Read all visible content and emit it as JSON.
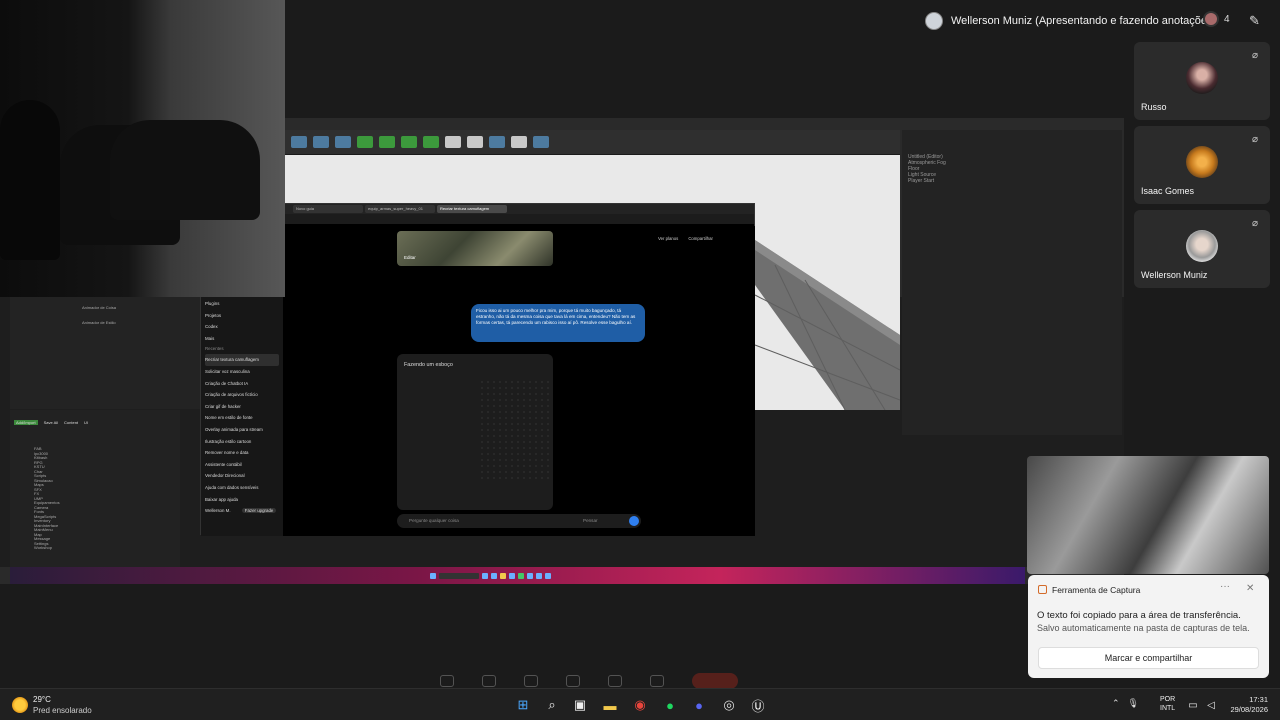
{
  "meeting": {
    "presenter_label": "Wellerson Muniz (Apresentando e fazendo anotações)",
    "people_count": "4",
    "participants": [
      {
        "name": "Russo"
      },
      {
        "name": "Isaac Gomes"
      },
      {
        "name": "Wellerson Muniz"
      }
    ]
  },
  "shared_screen": {
    "chrome_tabs": [
      "Novo guia",
      "equip_armas_super_heavy_01",
      "Recriar textura camuflagem"
    ],
    "gpt_sidebar": {
      "items_top": [
        "Plugins",
        "Projetos",
        "Codex",
        "Mais"
      ],
      "recent_heading": "Recentes",
      "recent": [
        "Recriar textura camuflagem",
        "Solicitar voz masculina",
        "Criação de Chatbot IA",
        "Criação de arquivos fictício",
        "Criar gif de hacker",
        "Nome em estilo de fonte",
        "Overlay animada para stream",
        "Ilustração estilo cartoon",
        "Remover nome e data",
        "Assistente contábil",
        "Vendedor Direcional",
        "Ajuda com dados sensíveis",
        "Baixar app ajuda"
      ],
      "user": "Wellerson M.",
      "upgrade": "Fazer upgrade"
    },
    "gpt_main": {
      "image_label": "Editar",
      "user_message": "Ficou isso ai um pouco melhor pra mim, porque tá muito bagunçado, tá estranho, não tá da mesma coisa que tava lá em cima, entendeu? Não tem as formas certas, tá parecendo um rabisco isso aí pô. Resolve esse bagulho aí.",
      "sketch_status": "Fazendo um esboço",
      "prompt_placeholder": "Pergunte qualquer coisa",
      "think_label": "Pensar",
      "header_actions": [
        "Ver planos",
        "Compartilhar"
      ]
    },
    "content_browser": {
      "toolbar": [
        "Add/Import",
        "Save All",
        "Content",
        "UI"
      ],
      "tree": [
        "FAB",
        "lpc3000",
        "Kitbash",
        "RPG",
        "KSTU",
        "Char",
        "Scripts",
        "Simulacao",
        "Maps",
        "SFX",
        "FX",
        "UMP",
        "Equipamentos",
        "Camera",
        "Fonts",
        "MegaScripts",
        "Inventory",
        "MainInterface",
        "MainMenu",
        "Map",
        "Message",
        "Settings",
        "Workshop"
      ]
    },
    "anim_items": [
      "Animador de Coisa",
      "Animador de Estilo"
    ],
    "outliner_rows": [
      "Untitled (Editor)",
      "Atmospheric Fog",
      "Floor",
      "Light Source",
      "Player Start"
    ]
  },
  "snipping_toast": {
    "app": "Ferramenta de Captura",
    "line1": "O texto foi copiado para a área de transferência.",
    "line2": "Salvo automaticamente na pasta de capturas de tela.",
    "button": "Marcar e compartilhar"
  },
  "taskbar": {
    "weather_temp": "29°C",
    "weather_desc": "Pred ensolarado",
    "lang_top": "POR",
    "lang_bottom": "INTL",
    "time": "17:31",
    "date": "29/08/2026"
  }
}
